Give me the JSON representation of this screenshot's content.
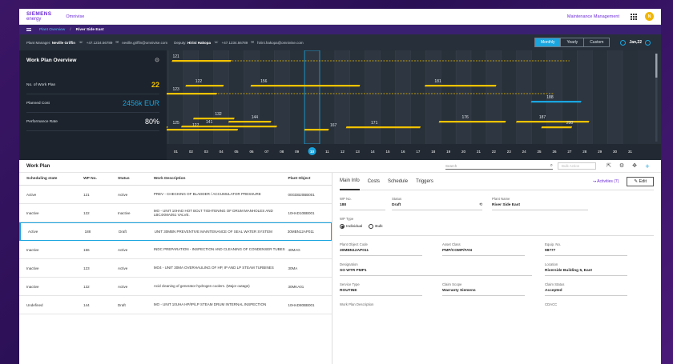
{
  "brand": {
    "line1": "SIEMENS",
    "line2": "energy",
    "app": "Omnivise"
  },
  "header": {
    "maintenance": "Maintenance Management",
    "avatar": "N"
  },
  "breadcrumb": {
    "first": "Plant Overview",
    "sep": "/",
    "last": "River Side East"
  },
  "info": {
    "pm_label": "Plant Manager:",
    "pm_name": "Neville Griffin",
    "pm_phone": "+47.1234.56789",
    "pm_email": "neville.griffin@omnivise.com",
    "dep_label": "Deputy:",
    "dep_name": "Hirini Hakopa",
    "dep_phone": "+47.1234.56789",
    "dep_email": "hirini.hakopa@omnivise.com",
    "views": [
      "Monthly",
      "Yearly",
      "Custom"
    ],
    "date": "Jan,22"
  },
  "overview": {
    "title": "Work Plan Overview",
    "rows": [
      {
        "label": "No. of Work Plan",
        "value": "22"
      },
      {
        "label": "Planned Cost",
        "value": "2456k EUR"
      },
      {
        "label": "Performance Rate",
        "value": "80%"
      }
    ]
  },
  "gantt": {
    "days": [
      "01",
      "02",
      "03",
      "04",
      "05",
      "06",
      "07",
      "08",
      "09",
      "10",
      "11",
      "12",
      "13",
      "14",
      "15",
      "16",
      "17",
      "18",
      "19",
      "20",
      "21",
      "22",
      "23",
      "24",
      "25",
      "26",
      "27",
      "28",
      "29",
      "30",
      "31"
    ],
    "current_day": "10",
    "bars": [
      {
        "label": "121",
        "start": 1,
        "end": 27,
        "dashed": true
      },
      {
        "label": "122",
        "start": 2.5,
        "end": 5
      },
      {
        "label": "156",
        "start": 6.8,
        "end": 14
      },
      {
        "label": "181",
        "start": 18.3,
        "end": 23
      },
      {
        "label": "123",
        "start": 1,
        "end": 26,
        "dashed": true
      },
      {
        "label": "188",
        "start": 25.7,
        "end": 29,
        "current": true
      },
      {
        "label": "132",
        "start": 3.8,
        "end": 6.5
      },
      {
        "label": "144",
        "start": 6.2,
        "end": 9
      },
      {
        "label": "176",
        "start": 20.1,
        "end": 24.5
      },
      {
        "label": "187",
        "start": 25.2,
        "end": 30
      },
      {
        "label": "141",
        "start": 3.2,
        "end": 9.5
      },
      {
        "label": "125",
        "start": 1,
        "end": 2.3
      },
      {
        "label": "127",
        "start": 2.3,
        "end": 7
      },
      {
        "label": "167",
        "start": 11.4,
        "end": 13
      },
      {
        "label": "171",
        "start": 14.1,
        "end": 19
      },
      {
        "label": "200",
        "start": 27,
        "end": 29
      }
    ]
  },
  "workplan": {
    "title": "Work Plan",
    "search_placeholder": "Search",
    "bulk_action": "Bulk Action",
    "columns": [
      "Scheduling state",
      "WP No.",
      "Status",
      "Work Description",
      "Plant Object"
    ],
    "rows": [
      [
        "Active",
        "121",
        "Active",
        "PREV - CHECKING OF BLADDER / ACCUMULATOR PRESSURE",
        "00GDB20BB001"
      ],
      [
        "Inactive",
        "122",
        "Inactive",
        "MO - UNIT 10HAD HOT BOLT TIGHTENING OF DRUM MANHOLES AND LBC4XMA051 VALVE.",
        "10HAD10BB001"
      ],
      [
        "Active",
        "188",
        "Draft",
        "UNIT 30MBN PREVENTIVE MAINTENANCE OF SEAL WATER SYSTEM",
        "30MBN12AP011"
      ],
      [
        "Inactive",
        "156",
        "Active",
        "INDC PREPARATION - INSPECTION AND CLEANING OF CONDENSER TUBES",
        "40MAG"
      ],
      [
        "Inactive",
        "123",
        "Active",
        "MO4 - UNIT 30MA OVERHAULING OF HP, IP AND LP STEAM TURBINES",
        "30MA"
      ],
      [
        "Inactive",
        "132",
        "Active",
        "Acid cleaning of generator hydrogen coolers. (Major outage)",
        "30MKA01"
      ],
      [
        "Undefined",
        "144",
        "Draft",
        "MO - UNIT 10UHA HP/IP/LP STEAM DRUM INTERNAL INSPECTION",
        "10HAD80BB001"
      ]
    ],
    "selected_row": 2
  },
  "detail": {
    "tabs": [
      "Main Info",
      "Costs",
      "Schedule",
      "Triggers"
    ],
    "activities": "Activities (7)",
    "edit": "Edit",
    "wp_no_label": "WP No.",
    "wp_no": "188",
    "status_label": "Status",
    "status": "Draft",
    "plant_label": "Plant Name",
    "plant": "River Side East",
    "type_label": "WP Type",
    "type_opts": [
      "Individual",
      "Bulk"
    ],
    "poc_label": "Plant Object Code",
    "poc": "30MBN12AP011",
    "asset_label": "Asset Class",
    "asset": "PMP/COMP/FAN",
    "equip_label": "Equip. No.",
    "equip": "98777",
    "desig_label": "Designation",
    "desig": "SO WTR PMP1",
    "loc_label": "Location",
    "loc": "Riverside Building 5, East",
    "svc_label": "Service Type",
    "svc": "ROUTINE",
    "claim_label": "Claim Scope",
    "claim": "Warranty Siemens",
    "cstatus_label": "Claim Status",
    "cstatus": "Accepted",
    "wpdesc_label": "Work Plan Description",
    "cdacc_label": "CDACC"
  },
  "colors": {
    "accent": "#1aa5df",
    "bar": "#f2c200",
    "brand": "#6c2bd9",
    "dark": "#262f3a"
  }
}
